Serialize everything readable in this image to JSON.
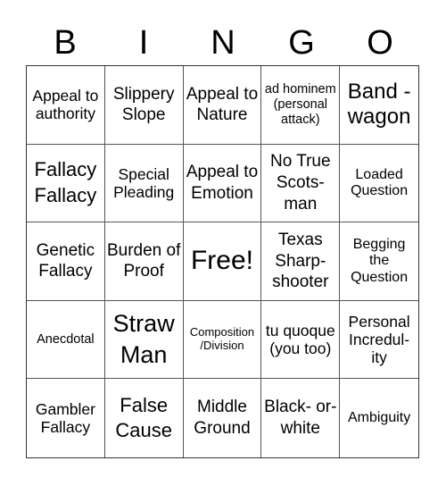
{
  "header": {
    "letters": [
      "B",
      "I",
      "N",
      "G",
      "O"
    ]
  },
  "cells": [
    [
      "Appeal to authority",
      "Slippery Slope",
      "Appeal to Nature",
      "ad hominem (personal attack)",
      "Band - wagon"
    ],
    [
      "Fallacy Fallacy",
      "Special Pleading",
      "Appeal to Emotion",
      "No True Scots- man",
      "Loaded Question"
    ],
    [
      "Genetic Fallacy",
      "Burden of Proof",
      "Free!",
      "Texas Sharp- shooter",
      "Begging the Question"
    ],
    [
      "Anecdotal",
      "Straw Man",
      "Composition /Division",
      "tu quoque (you too)",
      "Personal Incredul- ity"
    ],
    [
      "Gambler Fallacy",
      "False Cause",
      "Middle Ground",
      "Black- or- white",
      "Ambiguity"
    ]
  ]
}
